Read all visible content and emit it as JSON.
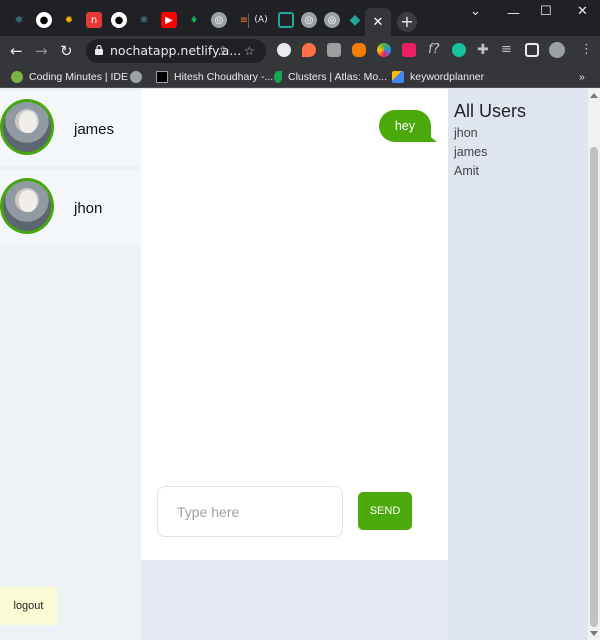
{
  "browser": {
    "url": "nochatapp.netlify.a...",
    "bookmarks": [
      {
        "label": "Coding Minutes | IDE",
        "icon": "check-circle-icon",
        "color": "#7cb342"
      },
      {
        "label": "",
        "icon": "globe-icon",
        "color": "#9aa0a6"
      },
      {
        "label": "Hitesh Choudhary -...",
        "icon": "square-icon",
        "color": "#000000"
      },
      {
        "label": "Clusters | Atlas: Mo...",
        "icon": "mongodb-leaf-icon",
        "color": "#13aa52"
      },
      {
        "label": "keywordplanner",
        "icon": "google-ads-icon",
        "color": "#4285f4"
      }
    ],
    "bookmarks_overflow": "»"
  },
  "sidebar": {
    "conversations": [
      {
        "name": "james"
      },
      {
        "name": "jhon"
      }
    ],
    "logout_label": "logout"
  },
  "chat": {
    "messages": [
      {
        "text": "hey",
        "from": "me"
      }
    ],
    "input_placeholder": "Type here",
    "input_value": "",
    "send_label": "SEND"
  },
  "users_panel": {
    "title": "All Users",
    "users": [
      "jhon",
      "james",
      "Amit"
    ]
  },
  "colors": {
    "accent": "#4ca90b",
    "avatar_ring": "#46a70e",
    "logout_bg": "#fbfbd5"
  }
}
